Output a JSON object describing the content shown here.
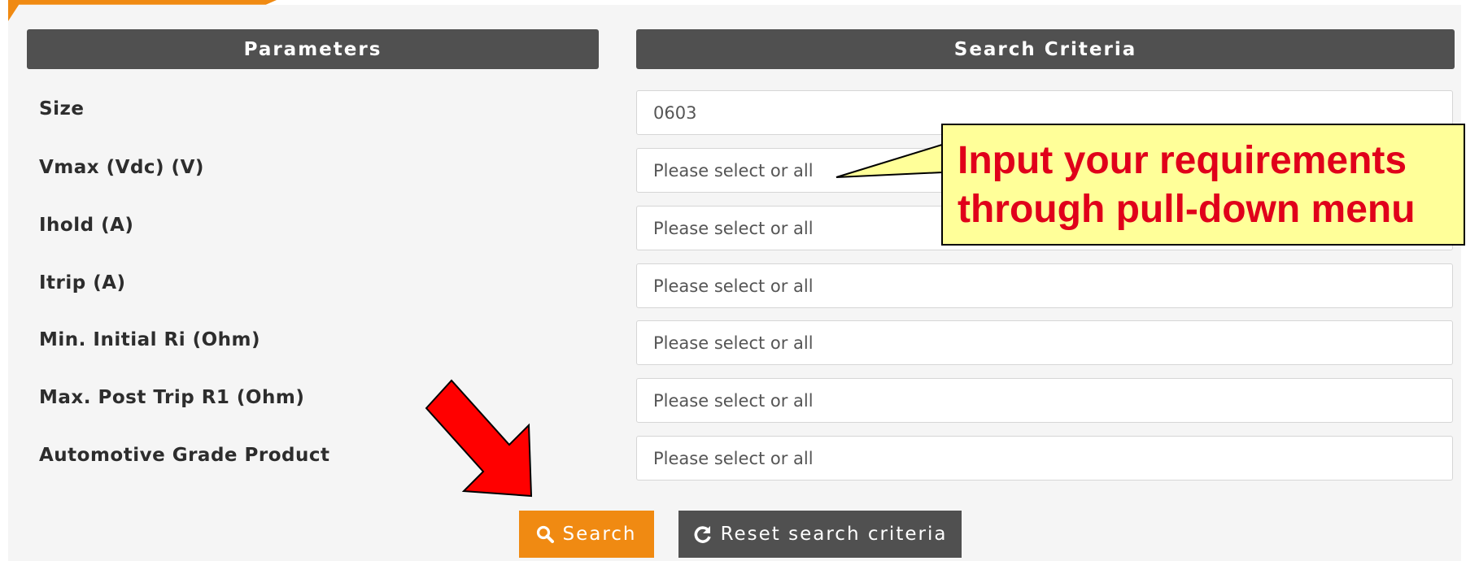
{
  "headers": {
    "parameters": "Parameters",
    "search_criteria": "Search Criteria"
  },
  "rows": [
    {
      "label": "Size",
      "value": "0603"
    },
    {
      "label": "Vmax (Vdc) (V)",
      "value": "Please select or all"
    },
    {
      "label": "Ihold (A)",
      "value": "Please select or all"
    },
    {
      "label": "Itrip (A)",
      "value": "Please select or all"
    },
    {
      "label": "Min. Initial Ri (Ohm)",
      "value": "Please select or all"
    },
    {
      "label": "Max. Post Trip R1 (Ohm)",
      "value": "Please select or all"
    },
    {
      "label": "Automotive Grade Product",
      "value": "Please select or all"
    }
  ],
  "buttons": {
    "search": "Search",
    "reset": "Reset search criteria"
  },
  "callout": {
    "line1": "Input your requirements",
    "line2": "through pull-down menu"
  },
  "colors": {
    "accent_orange": "#f08a12",
    "header_gray": "#505050",
    "callout_fill": "#ffff99",
    "callout_text": "#e0001a",
    "arrow_red": "#ff0000"
  },
  "icons": {
    "search": "search-icon",
    "reset": "refresh-icon"
  }
}
